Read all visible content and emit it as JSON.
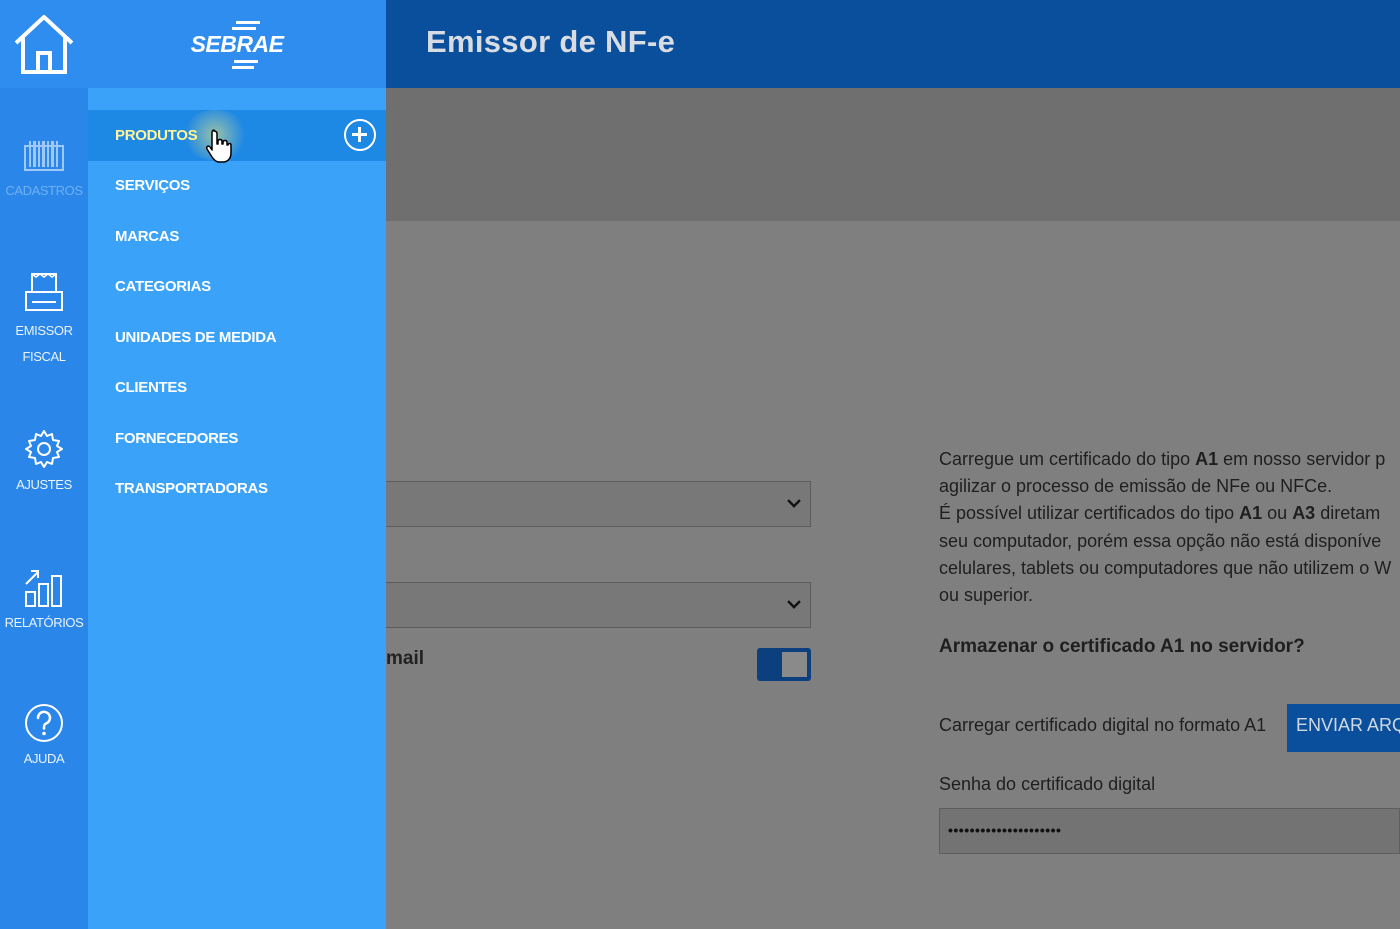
{
  "header": {
    "title": "Emissor de NF-e"
  },
  "brand": {
    "name": "SEBRAE"
  },
  "rail": {
    "items": [
      {
        "label": "CADASTROS",
        "icon": "barcode-icon"
      },
      {
        "label": "EMISSOR\nFISCAL",
        "icon": "receipt-printer-icon"
      },
      {
        "label": "AJUSTES",
        "icon": "gear-icon"
      },
      {
        "label": "RELATÓRIOS",
        "icon": "bar-chart-icon"
      },
      {
        "label": "AJUDA",
        "icon": "help-circle-icon"
      }
    ]
  },
  "menu": {
    "items": [
      {
        "label": "PRODUTOS",
        "active": true
      },
      {
        "label": "SERVIÇOS"
      },
      {
        "label": "MARCAS"
      },
      {
        "label": "CATEGORIAS"
      },
      {
        "label": "UNIDADES DE MEDIDA"
      },
      {
        "label": "CLIENTES"
      },
      {
        "label": "FORNECEDORES"
      },
      {
        "label": "TRANSPORTADORAS"
      }
    ]
  },
  "form": {
    "email_label": "mail",
    "toggle_on": true
  },
  "certificate": {
    "line1_a": "Carregue um certificado do tipo ",
    "line1_b": "A1",
    "line1_c": " em nosso servidor p",
    "line2": "agilizar o processo de emissão de NFe ou NFCe.",
    "line3_a": "É possível utilizar certificados do tipo ",
    "line3_b": "A1",
    "line3_c": " ou ",
    "line3_d": "A3",
    "line3_e": " diretam",
    "line4": "seu computador, porém essa opção não está disponíve",
    "line5": "celulares, tablets ou computadores que não utilizem o W",
    "line6": "ou superior.",
    "question": "Armazenar o certificado A1 no servidor?",
    "upload_label": "Carregar certificado digital no formato A1",
    "upload_button": "ENVIAR ARQ",
    "password_label": "Senha do certificado digital",
    "password_value": "•••••••••••••••••••••"
  },
  "colors": {
    "header": "#0a4f9c",
    "rail": "#2a86e8",
    "drawer": "#3aa3f9",
    "active_item": "#1e88e5"
  }
}
